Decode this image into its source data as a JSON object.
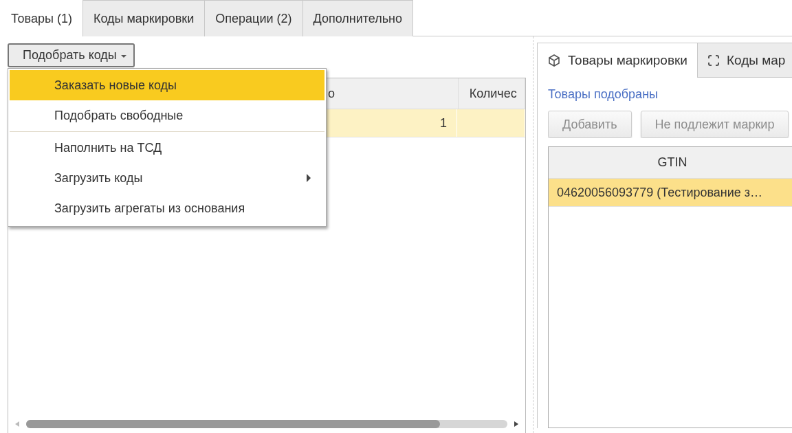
{
  "tabs": [
    {
      "label": "Товары (1)",
      "selected": true
    },
    {
      "label": "Коды маркировки",
      "selected": false
    },
    {
      "label": "Операции (2)",
      "selected": false
    },
    {
      "label": "Дополнительно",
      "selected": false
    }
  ],
  "pick_button": {
    "label": "Подобрать коды"
  },
  "menu": {
    "groups": [
      [
        {
          "label": "Заказать новые коды",
          "selected": true,
          "submenu": false
        },
        {
          "label": "Подобрать свободные",
          "selected": false,
          "submenu": false
        }
      ],
      [
        {
          "label": "Наполнить на ТСД",
          "selected": false,
          "submenu": false
        },
        {
          "label": "Загрузить коды",
          "selected": false,
          "submenu": true
        },
        {
          "label": "Загрузить агрегаты из основания",
          "selected": false,
          "submenu": false
        }
      ]
    ]
  },
  "table": {
    "columns": [
      {
        "label": "о"
      },
      {
        "label": "Количес"
      }
    ],
    "rows": [
      {
        "selected": true,
        "cells": [
          "1",
          ""
        ]
      }
    ]
  },
  "right_panel": {
    "tabs": [
      {
        "label": "Товары маркировки",
        "selected": true,
        "kind": "goods"
      },
      {
        "label": "Коды мар",
        "selected": false,
        "kind": "codes"
      }
    ],
    "link": "Товары подобраны",
    "buttons": [
      {
        "label": "Добавить",
        "disabled": true
      },
      {
        "label": "Не подлежит маркир",
        "disabled": true
      }
    ],
    "table": {
      "columns": [
        {
          "label": "GTIN"
        }
      ],
      "rows": [
        {
          "selected": true,
          "cells": [
            "04620056093779 (Тестирование з…"
          ]
        }
      ]
    }
  }
}
